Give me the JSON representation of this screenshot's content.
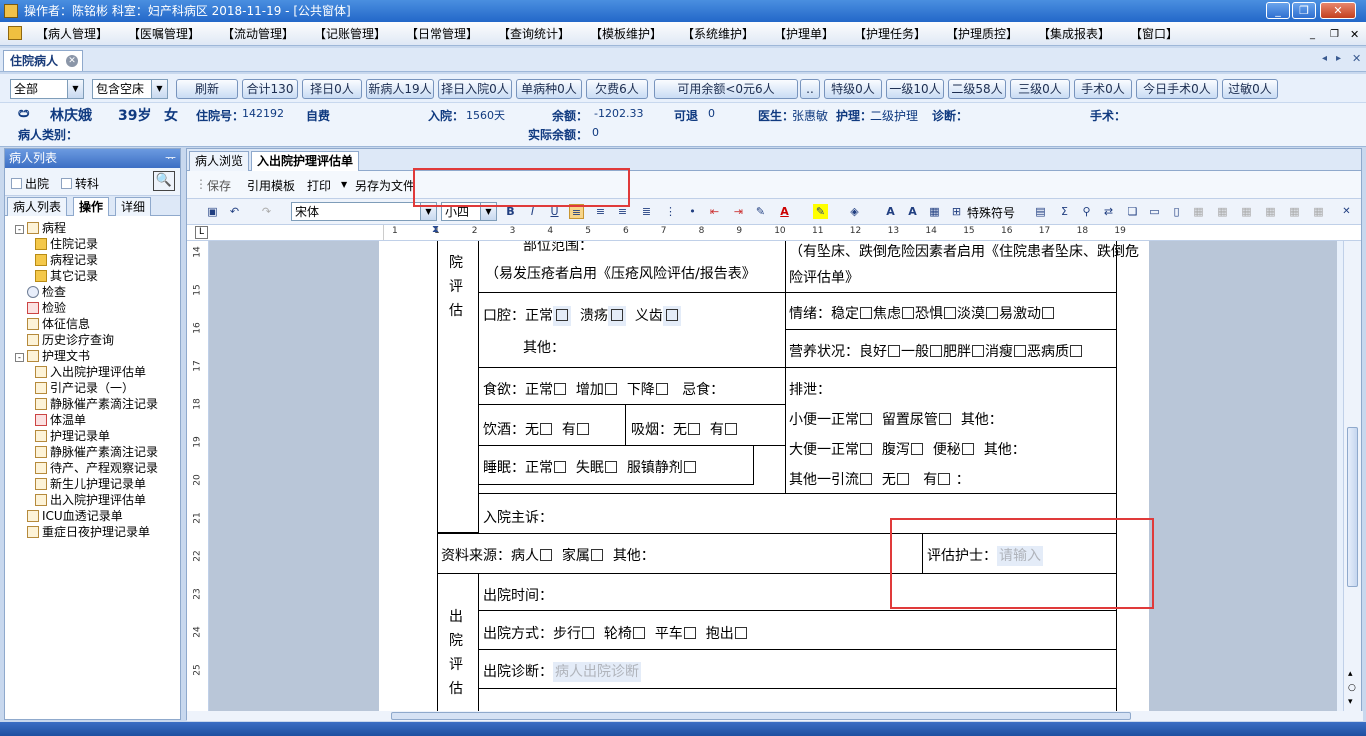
{
  "titlebar": {
    "title": "操作者：陈铭彬  科室：妇产科病区  2018-11-19 - [公共窗体]"
  },
  "menu": [
    "【病人管理】",
    "【医嘱管理】",
    "【流动管理】",
    "【记账管理】",
    "【日常管理】",
    "【查询统计】",
    "【模板维护】",
    "【系统维护】",
    "【护理单】",
    "【护理任务】",
    "【护理质控】",
    "【集成报表】",
    "【窗口】"
  ],
  "tab": {
    "label": "住院病人"
  },
  "filter": {
    "scope": "全部",
    "empty_bed": "包含空床",
    "buttons": [
      "刷新",
      "合计130",
      "择日0人",
      "新病人19人",
      "择日入院0人",
      "单病种0人",
      "欠费6人",
      "可用余额<0元6人",
      "..",
      "特级0人",
      "一级10人",
      "二级58人",
      "三级0人",
      "手术0人",
      "今日手术0人",
      "过敏0人"
    ]
  },
  "patient": {
    "bed": "ඏ",
    "name": "林庆娥",
    "age": "39岁",
    "sex": "女",
    "admission_no_label": "住院号：",
    "admission_no": "142192",
    "pay_type": "自费",
    "admit_label": "入院：",
    "admit_days": "1560天",
    "balance_label": "余额：",
    "balance": "-1202.33",
    "refundable_label": "可退",
    "refundable": "0",
    "doctor_label": "医生：",
    "doctor": "张惠敏",
    "care_label": "护理：",
    "care": "二级护理",
    "diagnosis_label": "诊断：",
    "surgery_label": "手术：",
    "type_label": "病人类别：",
    "actual_label": "实际余额：",
    "actual": "0"
  },
  "leftpanel": {
    "title": "病人列表",
    "pin": "ᅲ",
    "opt_discharge": "出院",
    "opt_transfer": "转科",
    "tabs": [
      "病人列表",
      "操作",
      "详细"
    ],
    "tree": [
      {
        "label": "病程",
        "level": 0,
        "icon": "doc",
        "exp": "-"
      },
      {
        "label": "住院记录",
        "level": 1,
        "icon": "folder"
      },
      {
        "label": "病程记录",
        "level": 1,
        "icon": "folder"
      },
      {
        "label": "其它记录",
        "level": 1,
        "icon": "folder"
      },
      {
        "label": "检查",
        "level": 0,
        "icon": "mag"
      },
      {
        "label": "检验",
        "level": 0,
        "icon": "red"
      },
      {
        "label": "体征信息",
        "level": 0,
        "icon": "doc"
      },
      {
        "label": "历史诊疗查询",
        "level": 0,
        "icon": "doc"
      },
      {
        "label": "护理文书",
        "level": 0,
        "icon": "doc",
        "exp": "-"
      },
      {
        "label": "入出院护理评估单",
        "level": 1,
        "icon": "doc"
      },
      {
        "label": "引产记录（一）",
        "level": 1,
        "icon": "doc"
      },
      {
        "label": "静脉催产素滴注记录",
        "level": 1,
        "icon": "doc"
      },
      {
        "label": "体温单",
        "level": 1,
        "icon": "red"
      },
      {
        "label": "护理记录单",
        "level": 1,
        "icon": "doc"
      },
      {
        "label": "静脉催产素滴注记录",
        "level": 1,
        "icon": "doc"
      },
      {
        "label": "待产、产程观察记录",
        "level": 1,
        "icon": "doc"
      },
      {
        "label": "新生儿护理记录单",
        "level": 1,
        "icon": "doc"
      },
      {
        "label": "出入院护理评估单",
        "level": 1,
        "icon": "doc"
      },
      {
        "label": "ICU血透记录单",
        "level": 0,
        "icon": "doc"
      },
      {
        "label": "重症日夜护理记录单",
        "level": 0,
        "icon": "doc"
      }
    ]
  },
  "editor": {
    "tabs": [
      "病人浏览",
      "入出院护理评估单"
    ],
    "actions": [
      "保存",
      "引用模板",
      "打印",
      "另存为文件"
    ],
    "font_name": "宋体",
    "font_size": "小四",
    "special_symbol": "特殊符号",
    "ruler_marks": [
      "1",
      "1",
      "2",
      "3",
      "4",
      "5",
      "6",
      "7",
      "8",
      "9",
      "10",
      "11",
      "12",
      "13",
      "14",
      "15",
      "16",
      "17",
      "18",
      "19"
    ],
    "vruler_marks": [
      "14",
      "15",
      "16",
      "17",
      "18",
      "19",
      "20",
      "21",
      "22",
      "23",
      "24",
      "25"
    ]
  },
  "form": {
    "admit_section": "院\n评\n估",
    "discharge_section": "出\n院\n评\n估",
    "top_left_partial": "部位范围：",
    "pressure_note": "（易发压疮者启用《压疮风险评估/报告表》",
    "fall_note_1": "（有坠床、跌倒危险因素者启用《住院患者坠床、跌倒危",
    "fall_note_2": "险评估单》",
    "oral": "口腔：正常",
    "oral_ulcer": "溃疡",
    "oral_denture": "义齿",
    "oral_other": "其他：",
    "mood": "情绪：稳定",
    "mood_anx": "焦虑",
    "mood_fear": "恐惧",
    "mood_cold": "淡漠",
    "mood_irr": "易激动",
    "nutrition": "营养状况：良好",
    "nut_avg": "一般",
    "nut_fat": "肥胖",
    "nut_thin": "消瘦",
    "nut_bad": "恶病质",
    "appetite": "食欲：正常",
    "app_up": "增加",
    "app_down": "下降",
    "app_avoid": "忌食：",
    "excretion": "排泄：",
    "urine": "小便一正常",
    "urine_cath": "留置尿管",
    "urine_other": "其他：",
    "stool": "大便一正常",
    "stool_diar": "腹泻",
    "stool_const": "便秘",
    "stool_other": "其他：",
    "drain": "其他一引流",
    "drain_no": "无",
    "drain_yes": "有",
    "drain_colon": "：",
    "drink": "饮酒：无",
    "drink_yes": "有",
    "smoke": "吸烟：无",
    "smoke_yes": "有",
    "sleep": "睡眠：正常",
    "sleep_bad": "失眠",
    "sleep_pill": "服镇静剂",
    "complaint": "入院主诉：",
    "source": "资料来源：病人",
    "source_family": "家属",
    "source_other": "其他：",
    "nurse_label": "评估护士：",
    "nurse_ph": "请输入",
    "discharge_time": "出院时间：",
    "discharge_mode": "出院方式：步行",
    "mode_wheel": "轮椅",
    "mode_cart": "平车",
    "mode_carry": "抱出",
    "discharge_dx": "出院诊断：",
    "discharge_dx_ph": "病人出院诊断"
  }
}
